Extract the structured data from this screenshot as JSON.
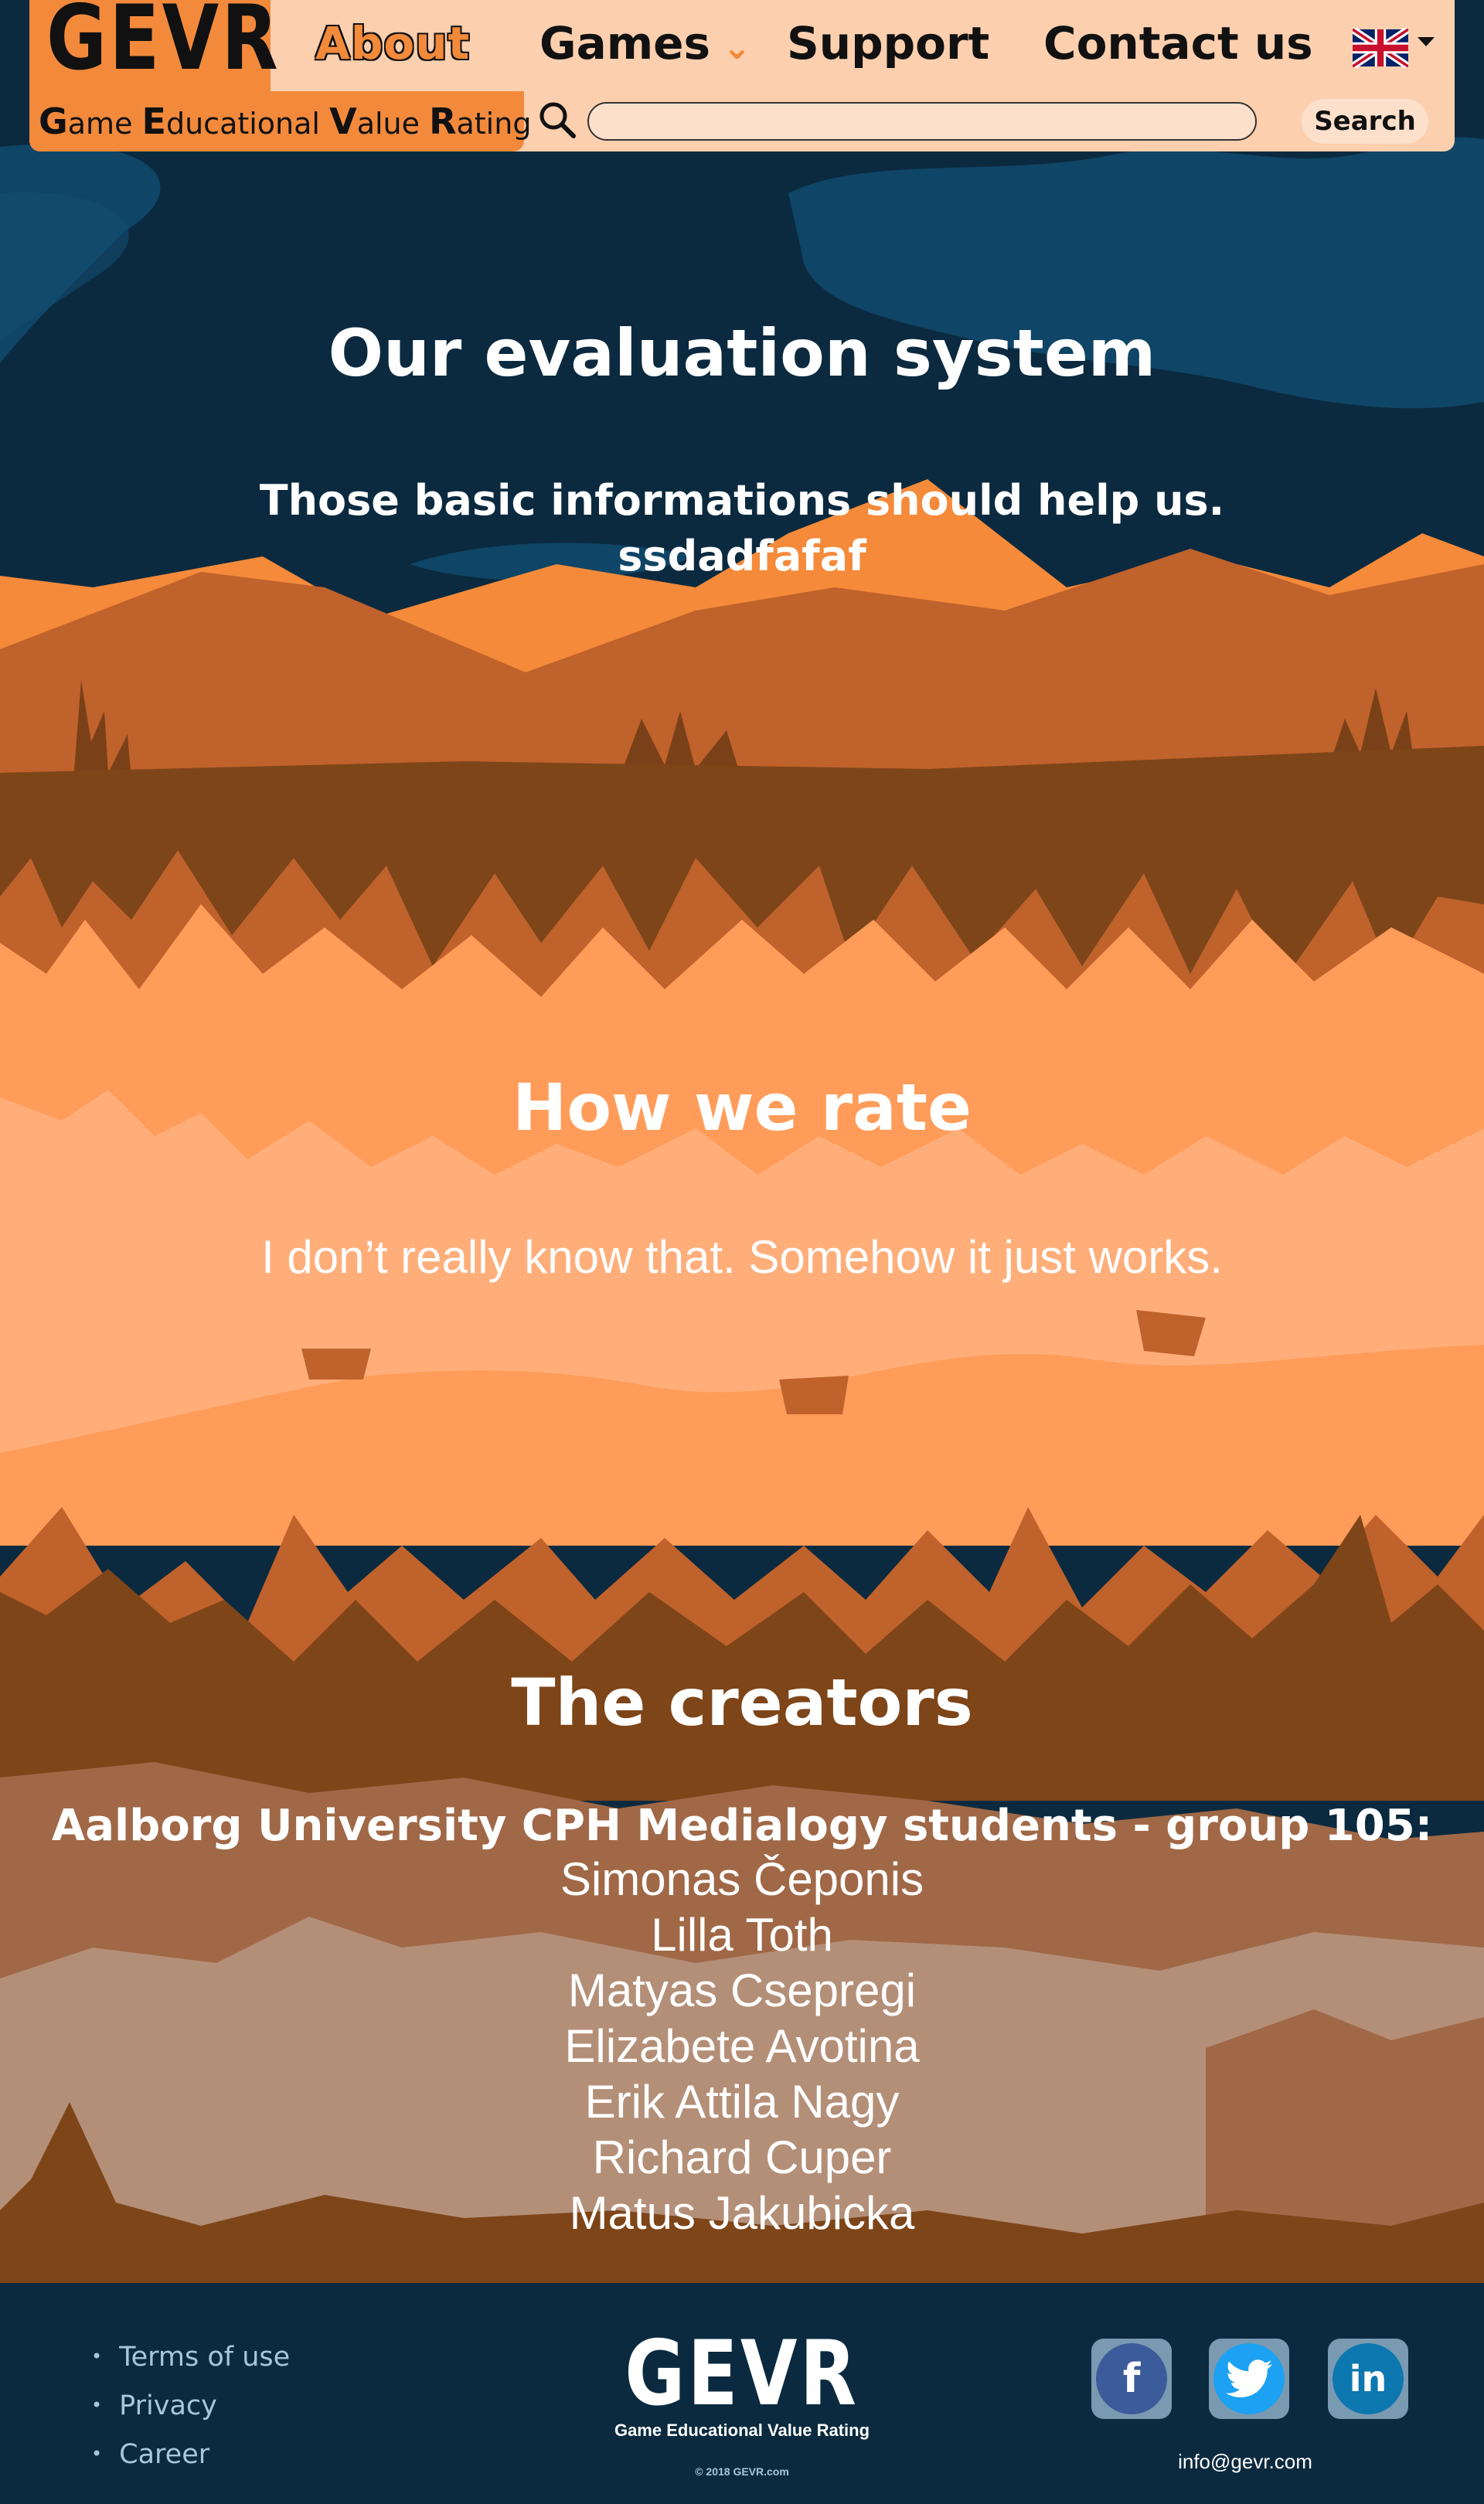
{
  "brand": {
    "logo": "GEVR",
    "tagline_parts": [
      {
        "cap": "G",
        "rest": "ame "
      },
      {
        "cap": "E",
        "rest": "ducational "
      },
      {
        "cap": "V",
        "rest": "alue "
      },
      {
        "cap": "R",
        "rest": "ating"
      }
    ]
  },
  "nav": {
    "about": "About",
    "games": "Games",
    "support": "Support",
    "contact": "Contact us",
    "language_icon": "uk-flag-icon"
  },
  "search": {
    "value": "",
    "placeholder": "",
    "button_label": "Search",
    "icon": "magnifier-icon"
  },
  "sections": {
    "evaluation": {
      "title": "Our evaluation system",
      "line1": "Those basic informations should help us.",
      "line2": "ssdadfafaf"
    },
    "rating": {
      "title": "How we rate",
      "text": "I don’t really know that. Somehow it just works."
    },
    "creators": {
      "title": "The creators",
      "group": "Aalborg University CPH Medialogy students - group 105:",
      "members": [
        "Simonas Čeponis",
        "Lilla Toth",
        "Matyas Csepregi",
        "Elizabete Avotina",
        "Erik Attila Nagy",
        "Richard Cuper",
        "Matus Jakubicka"
      ]
    }
  },
  "footer": {
    "links": [
      "Terms of use",
      "Privacy",
      "Career"
    ],
    "logo": "GEVR",
    "tagline": "Game Educational Value Rating",
    "copyright": "© 2018 GEVR.com",
    "email": "info@gevr.com",
    "social": [
      "facebook-icon",
      "twitter-icon",
      "linkedin-icon"
    ]
  },
  "colors": {
    "accent_orange": "#f38a3b",
    "header_bg": "#fccfae",
    "navy": "#0b2a3f"
  }
}
